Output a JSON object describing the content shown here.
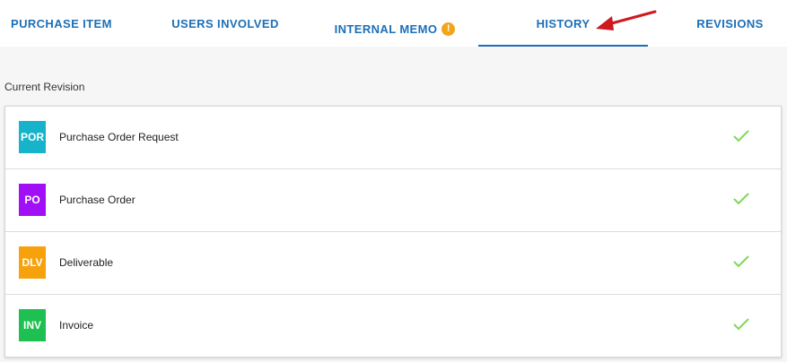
{
  "tabs": {
    "purchase_item": "PURCHASE ITEM",
    "users_involved": "USERS INVOLVED",
    "internal_memo": "INTERNAL MEMO",
    "internal_memo_alert": "!",
    "history": "HISTORY",
    "revisions": "REVISIONS",
    "active": "HISTORY"
  },
  "section": {
    "label": "Current Revision"
  },
  "rows": [
    {
      "code": "POR",
      "label": "Purchase Order Request",
      "color": "#16b3cb",
      "status": "check-icon"
    },
    {
      "code": "PO",
      "label": "Purchase Order",
      "color": "#a00ff5",
      "status": "check-icon"
    },
    {
      "code": "DLV",
      "label": "Deliverable",
      "color": "#f7a20c",
      "status": "check-icon"
    },
    {
      "code": "INV",
      "label": "Invoice",
      "color": "#1ec151",
      "status": "check-icon"
    }
  ],
  "colors": {
    "accent": "#1b6fb8",
    "alert": "#f2a51a",
    "check": "#7ed957",
    "arrow": "#d0181f"
  }
}
